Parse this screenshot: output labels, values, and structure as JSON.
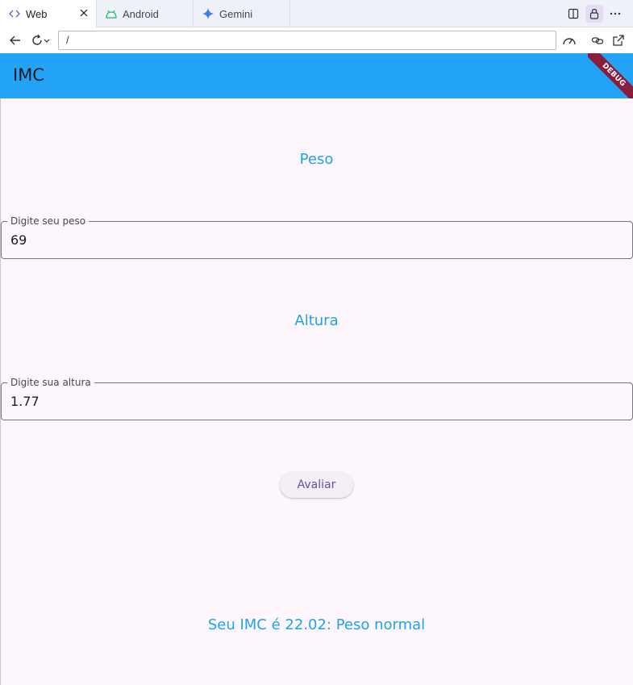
{
  "browser": {
    "tabs": [
      {
        "label": "Web",
        "icon": "code-icon"
      },
      {
        "label": "Android",
        "icon": "android-icon"
      },
      {
        "label": "Gemini",
        "icon": "gemini-sparkle-icon"
      }
    ],
    "url": "/"
  },
  "app": {
    "title": "IMC",
    "debug_banner": "DEBUG",
    "accent_color": "#23a4f6",
    "label_color": "#1ea3ec"
  },
  "form": {
    "weight_heading": "Peso",
    "weight_label": "Digite seu peso",
    "weight_value": "69",
    "height_heading": "Altura",
    "height_label": "Digite sua altura",
    "height_value": "1.77",
    "submit_label": "Avaliar"
  },
  "result": {
    "text": "Seu IMC é 22.02: Peso normal"
  }
}
